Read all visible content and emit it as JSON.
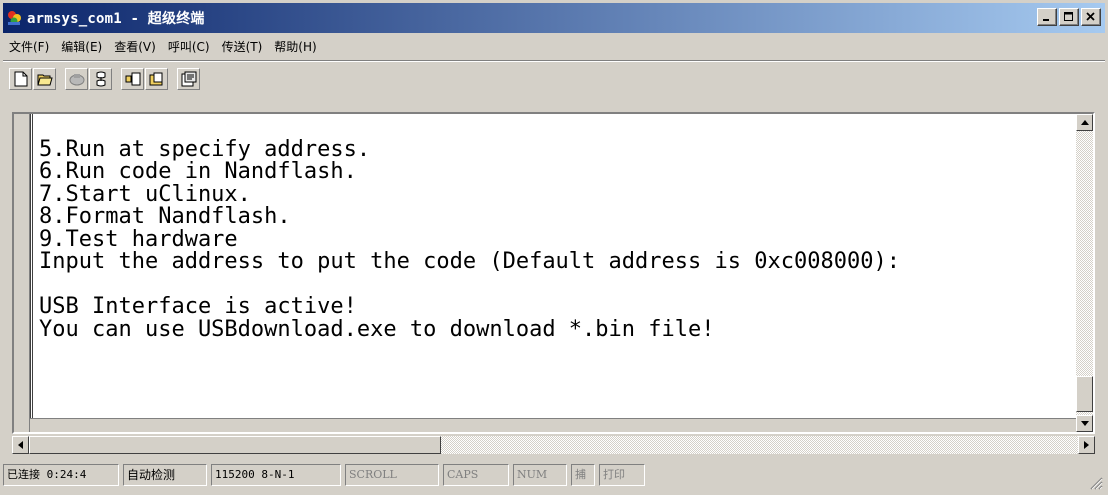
{
  "window": {
    "title": "armsys_com1 - 超级终端",
    "buttons": {
      "minimize": "_",
      "maximize": "□",
      "close": "×"
    }
  },
  "menu": [
    "文件(F)",
    "编辑(E)",
    "查看(V)",
    "呼叫(C)",
    "传送(T)",
    "帮助(H)"
  ],
  "toolbar": [
    {
      "icon": "new-icon"
    },
    {
      "icon": "open-icon"
    },
    {
      "icon": "disconnect-icon"
    },
    {
      "icon": "properties-dial-icon"
    },
    {
      "icon": "send-icon"
    },
    {
      "icon": "receive-icon"
    },
    {
      "icon": "properties-icon"
    }
  ],
  "terminal": {
    "lines": [
      "5.Run at specify address.",
      "6.Run code in Nandflash.",
      "7.Start uClinux.",
      "8.Format Nandflash.",
      "9.Test hardware",
      "Input the address to put the code (Default address is 0xc008000):",
      "",
      "USB Interface is active!",
      "You can use USBdownload.exe to download *.bin file!"
    ]
  },
  "status": {
    "connected": "已连接 0:24:4",
    "detect": "自动检测",
    "port": "115200 8-N-1",
    "scroll": "SCROLL",
    "caps": "CAPS",
    "num": "NUM",
    "capture": "捕",
    "print": "打印"
  },
  "colors": {
    "titlebar_start": "#0a246a",
    "titlebar_end": "#a6caf0",
    "face": "#d4d0c8"
  }
}
